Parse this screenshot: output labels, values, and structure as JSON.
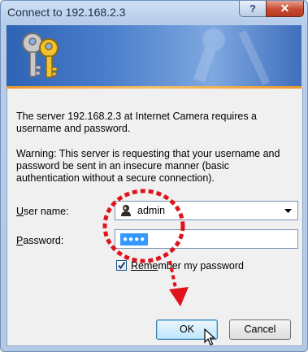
{
  "dialog": {
    "title": "Connect to 192.168.2.3",
    "help_glyph": "?",
    "close_glyph": "✕"
  },
  "message": {
    "line1": "The server 192.168.2.3 at Internet Camera requires a",
    "line2": "username and password.",
    "warning1": "Warning: This server is requesting that your username and",
    "warning2": "password be sent in an insecure manner (basic",
    "warning3": "authentication without a secure connection)."
  },
  "form": {
    "username_label_underlined": "U",
    "username_label_rest": "ser name:",
    "username_value": "admin",
    "password_label_underlined": "P",
    "password_label_rest": "assword:",
    "password_mask": "●●●●",
    "remember_underlined": "Reme",
    "remember_rest": "mber my password",
    "remember_checked": true
  },
  "buttons": {
    "ok": "OK",
    "cancel": "Cancel"
  },
  "icons": {
    "banner": "keys-icon",
    "user_combo": "user-icon",
    "dropdown": "chevron-down-icon"
  },
  "colors": {
    "annotation_red": "#e0131a",
    "banner_blue": "#3a6fbe",
    "accent_orange": "#f09a2a"
  }
}
